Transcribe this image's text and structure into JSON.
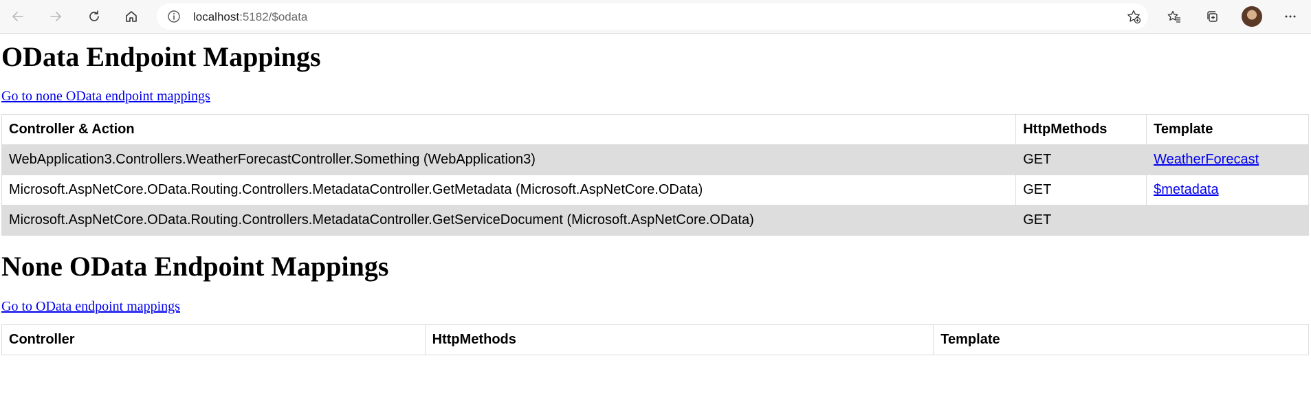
{
  "browser": {
    "url_host": "localhost",
    "url_rest": ":5182/$odata",
    "icons": [
      "back-icon",
      "forward-icon",
      "refresh-icon",
      "home-icon",
      "info-icon",
      "favorite-add-icon",
      "favorites-icon",
      "collections-icon",
      "profile-avatar",
      "more-icon"
    ]
  },
  "odata": {
    "heading": "OData Endpoint Mappings",
    "link": "Go to none OData endpoint mappings",
    "headers": [
      "Controller & Action",
      "HttpMethods",
      "Template"
    ],
    "rows": [
      {
        "action": "WebApplication3.Controllers.WeatherForecastController.Something (WebApplication3)",
        "methods": "GET",
        "template": "WeatherForecast"
      },
      {
        "action": "Microsoft.AspNetCore.OData.Routing.Controllers.MetadataController.GetMetadata (Microsoft.AspNetCore.OData)",
        "methods": "GET",
        "template": "$metadata"
      },
      {
        "action": "Microsoft.AspNetCore.OData.Routing.Controllers.MetadataController.GetServiceDocument (Microsoft.AspNetCore.OData)",
        "methods": "GET",
        "template": ""
      }
    ]
  },
  "non_odata": {
    "heading": "None OData Endpoint Mappings",
    "link": "Go to OData endpoint mappings",
    "headers": [
      "Controller",
      "HttpMethods",
      "Template"
    ]
  }
}
